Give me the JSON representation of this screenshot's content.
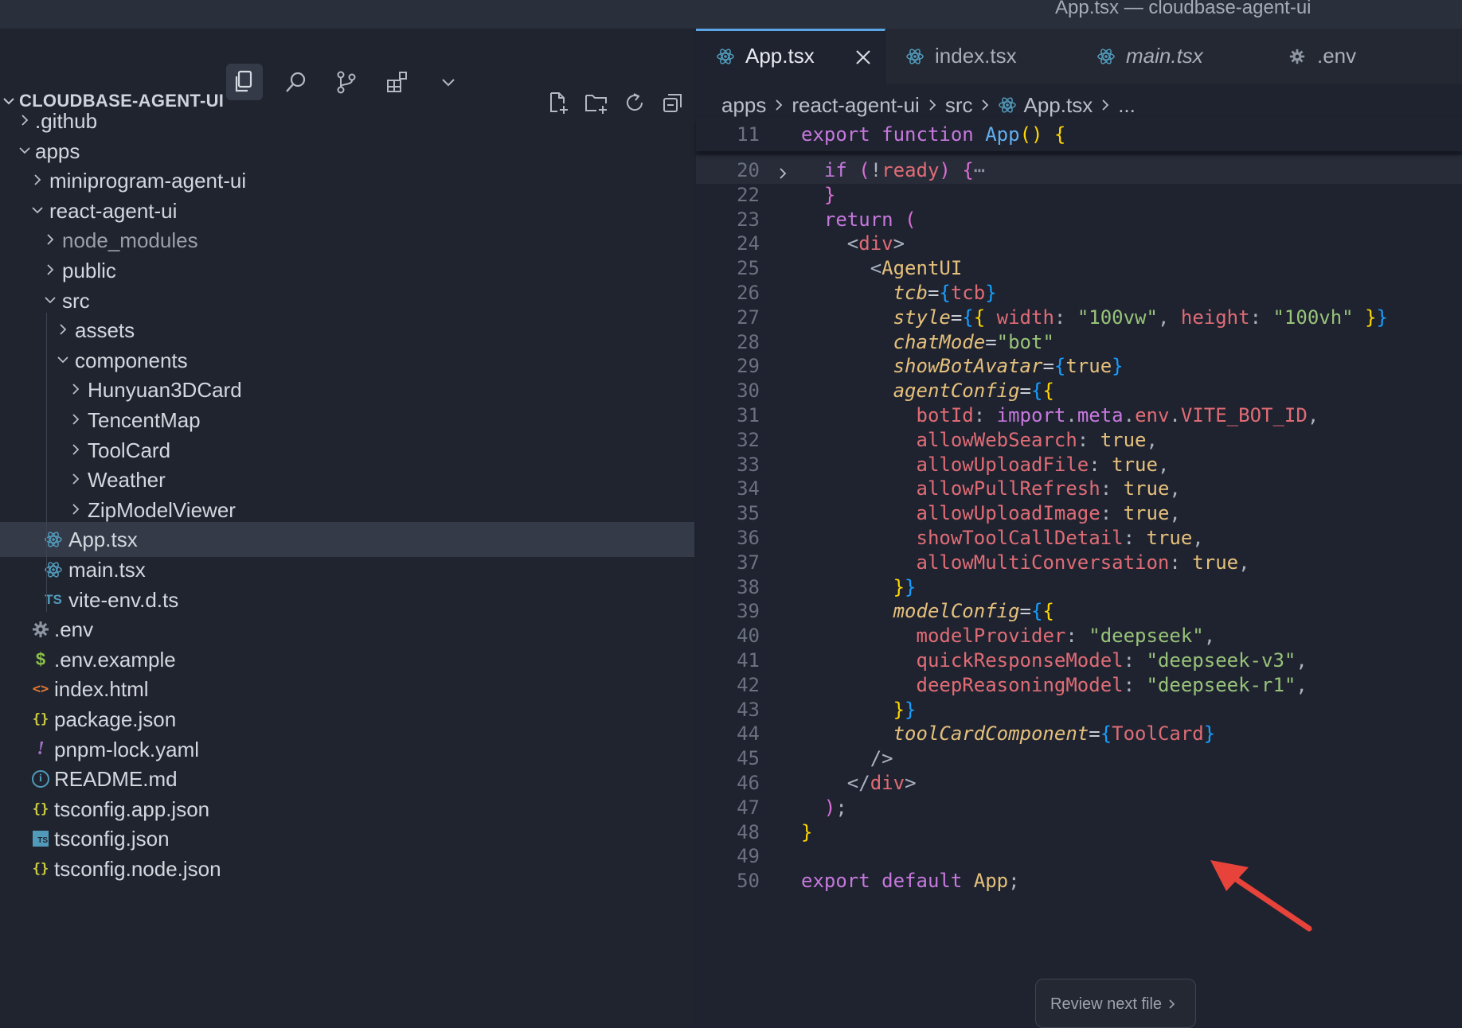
{
  "window": {
    "title": "App.tsx — cloudbase-agent-ui"
  },
  "activity_icons": [
    "files-icon",
    "search-icon",
    "source-control-icon",
    "extensions-icon",
    "more-chevron-icon"
  ],
  "explorer": {
    "section_title": "CLOUDBASE-AGENT-UI",
    "tools": [
      "new-file-icon",
      "new-folder-icon",
      "refresh-icon",
      "collapse-all-icon"
    ],
    "items": [
      {
        "label": ".github",
        "kind": "folder",
        "expanded": false,
        "depth": 1
      },
      {
        "label": "apps",
        "kind": "folder",
        "expanded": true,
        "depth": 1
      },
      {
        "label": "miniprogram-agent-ui",
        "kind": "folder",
        "expanded": false,
        "depth": 2
      },
      {
        "label": "react-agent-ui",
        "kind": "folder",
        "expanded": true,
        "depth": 2
      },
      {
        "label": "node_modules",
        "kind": "folder",
        "expanded": false,
        "depth": 3,
        "dim": true
      },
      {
        "label": "public",
        "kind": "folder",
        "expanded": false,
        "depth": 3
      },
      {
        "label": "src",
        "kind": "folder",
        "expanded": true,
        "depth": 3
      },
      {
        "label": "assets",
        "kind": "folder",
        "expanded": false,
        "depth": 4
      },
      {
        "label": "components",
        "kind": "folder",
        "expanded": true,
        "depth": 4
      },
      {
        "label": "Hunyuan3DCard",
        "kind": "folder",
        "expanded": false,
        "depth": 5
      },
      {
        "label": "TencentMap",
        "kind": "folder",
        "expanded": false,
        "depth": 5
      },
      {
        "label": "ToolCard",
        "kind": "folder",
        "expanded": false,
        "depth": 5
      },
      {
        "label": "Weather",
        "kind": "folder",
        "expanded": false,
        "depth": 5
      },
      {
        "label": "ZipModelViewer",
        "kind": "folder",
        "expanded": false,
        "depth": 5
      },
      {
        "label": "App.tsx",
        "kind": "file",
        "icon": "react-icon",
        "depth": 4,
        "selected": true
      },
      {
        "label": "main.tsx",
        "kind": "file",
        "icon": "react-icon",
        "depth": 4
      },
      {
        "label": "vite-env.d.ts",
        "kind": "file",
        "icon": "typescript-icon",
        "icon_text": "TS",
        "depth": 4
      },
      {
        "label": ".env",
        "kind": "file",
        "icon": "gear-icon",
        "depth": 3
      },
      {
        "label": ".env.example",
        "kind": "file",
        "icon": "dollar-icon",
        "icon_text": "$",
        "depth": 3
      },
      {
        "label": "index.html",
        "kind": "file",
        "icon": "html-icon",
        "icon_text": "<>",
        "depth": 3
      },
      {
        "label": "package.json",
        "kind": "file",
        "icon": "json-icon",
        "icon_text": "{}",
        "depth": 3
      },
      {
        "label": "pnpm-lock.yaml",
        "kind": "file",
        "icon": "yaml-icon",
        "icon_text": "!",
        "depth": 3
      },
      {
        "label": "README.md",
        "kind": "file",
        "icon": "info-icon",
        "icon_text": "i",
        "depth": 3
      },
      {
        "label": "tsconfig.app.json",
        "kind": "file",
        "icon": "json-icon",
        "icon_text": "{}",
        "depth": 3
      },
      {
        "label": "tsconfig.json",
        "kind": "file",
        "icon": "tsconfig-icon",
        "icon_text": "TS",
        "depth": 3
      },
      {
        "label": "tsconfig.node.json",
        "kind": "file",
        "icon": "json-icon",
        "icon_text": "{}",
        "depth": 3
      }
    ]
  },
  "tabs": [
    {
      "label": "App.tsx",
      "icon": "react-icon",
      "active": true,
      "italic": false,
      "close": "×"
    },
    {
      "label": "index.tsx",
      "icon": "react-icon",
      "active": false,
      "italic": false
    },
    {
      "label": "main.tsx",
      "icon": "react-icon",
      "active": false,
      "italic": true
    },
    {
      "label": ".env",
      "icon": "gear-icon",
      "active": false,
      "italic": false
    }
  ],
  "breadcrumbs": [
    "apps",
    "react-agent-ui",
    "src",
    "App.tsx",
    "..."
  ],
  "editor": {
    "sticky": {
      "line": "11",
      "tokens": [
        [
          "kw",
          "export"
        ],
        [
          "plain",
          " "
        ],
        [
          "kw",
          "function"
        ],
        [
          "plain",
          " "
        ],
        [
          "fn",
          "App"
        ],
        [
          "br1",
          "()"
        ],
        [
          "plain",
          " "
        ],
        [
          "br1",
          "{"
        ]
      ]
    },
    "lines": [
      {
        "n": "20",
        "fold": true,
        "hl": true,
        "tokens": [
          [
            "plain",
            "  "
          ],
          [
            "kw",
            "if"
          ],
          [
            "plain",
            " "
          ],
          [
            "br2",
            "("
          ],
          [
            "pu",
            "!"
          ],
          [
            "ident",
            "ready"
          ],
          [
            "br2",
            ")"
          ],
          [
            "plain",
            " "
          ],
          [
            "br2",
            "{"
          ],
          [
            "ellipsis",
            "⋯"
          ]
        ]
      },
      {
        "n": "22",
        "tokens": [
          [
            "plain",
            "  "
          ],
          [
            "br2",
            "}"
          ]
        ]
      },
      {
        "n": "23",
        "tokens": [
          [
            "plain",
            "  "
          ],
          [
            "kw",
            "return"
          ],
          [
            "plain",
            " "
          ],
          [
            "br2",
            "("
          ]
        ]
      },
      {
        "n": "24",
        "tokens": [
          [
            "plain",
            "    "
          ],
          [
            "pu",
            "<"
          ],
          [
            "tag",
            "div"
          ],
          [
            "pu",
            ">"
          ]
        ]
      },
      {
        "n": "25",
        "tokens": [
          [
            "plain",
            "      "
          ],
          [
            "pu",
            "<"
          ],
          [
            "attr-n",
            "AgentUI"
          ]
        ]
      },
      {
        "n": "26",
        "tokens": [
          [
            "plain",
            "        "
          ],
          [
            "attr",
            "tcb"
          ],
          [
            "op",
            "="
          ],
          [
            "br3",
            "{"
          ],
          [
            "ident",
            "tcb"
          ],
          [
            "br3",
            "}"
          ]
        ]
      },
      {
        "n": "27",
        "tokens": [
          [
            "plain",
            "        "
          ],
          [
            "attr",
            "style"
          ],
          [
            "op",
            "="
          ],
          [
            "br3",
            "{"
          ],
          [
            "br1",
            "{"
          ],
          [
            "plain",
            " "
          ],
          [
            "prop",
            "width"
          ],
          [
            "pu",
            ": "
          ],
          [
            "str",
            "\"100vw\""
          ],
          [
            "pu",
            ", "
          ],
          [
            "prop",
            "height"
          ],
          [
            "pu",
            ": "
          ],
          [
            "str",
            "\"100vh\""
          ],
          [
            "plain",
            " "
          ],
          [
            "br1",
            "}"
          ],
          [
            "br3",
            "}"
          ]
        ]
      },
      {
        "n": "28",
        "tokens": [
          [
            "plain",
            "        "
          ],
          [
            "attr",
            "chatMode"
          ],
          [
            "op",
            "="
          ],
          [
            "str",
            "\"bot\""
          ]
        ]
      },
      {
        "n": "29",
        "tokens": [
          [
            "plain",
            "        "
          ],
          [
            "attr",
            "showBotAvatar"
          ],
          [
            "op",
            "="
          ],
          [
            "br3",
            "{"
          ],
          [
            "bool",
            "true"
          ],
          [
            "br3",
            "}"
          ]
        ]
      },
      {
        "n": "30",
        "tokens": [
          [
            "plain",
            "        "
          ],
          [
            "attr",
            "agentConfig"
          ],
          [
            "op",
            "="
          ],
          [
            "br3",
            "{"
          ],
          [
            "br1",
            "{"
          ]
        ]
      },
      {
        "n": "31",
        "tokens": [
          [
            "plain",
            "          "
          ],
          [
            "prop",
            "botId"
          ],
          [
            "pu",
            ": "
          ],
          [
            "meta",
            "import"
          ],
          [
            "pu",
            "."
          ],
          [
            "meta",
            "meta"
          ],
          [
            "pu",
            "."
          ],
          [
            "env",
            "env"
          ],
          [
            "pu",
            "."
          ],
          [
            "env",
            "VITE_BOT_ID"
          ],
          [
            "pu",
            ","
          ]
        ]
      },
      {
        "n": "32",
        "tokens": [
          [
            "plain",
            "          "
          ],
          [
            "prop",
            "allowWebSearch"
          ],
          [
            "pu",
            ": "
          ],
          [
            "bool",
            "true"
          ],
          [
            "pu",
            ","
          ]
        ]
      },
      {
        "n": "33",
        "tokens": [
          [
            "plain",
            "          "
          ],
          [
            "prop",
            "allowUploadFile"
          ],
          [
            "pu",
            ": "
          ],
          [
            "bool",
            "true"
          ],
          [
            "pu",
            ","
          ]
        ]
      },
      {
        "n": "34",
        "tokens": [
          [
            "plain",
            "          "
          ],
          [
            "prop",
            "allowPullRefresh"
          ],
          [
            "pu",
            ": "
          ],
          [
            "bool",
            "true"
          ],
          [
            "pu",
            ","
          ]
        ]
      },
      {
        "n": "35",
        "tokens": [
          [
            "plain",
            "          "
          ],
          [
            "prop",
            "allowUploadImage"
          ],
          [
            "pu",
            ": "
          ],
          [
            "bool",
            "true"
          ],
          [
            "pu",
            ","
          ]
        ]
      },
      {
        "n": "36",
        "tokens": [
          [
            "plain",
            "          "
          ],
          [
            "prop",
            "showToolCallDetail"
          ],
          [
            "pu",
            ": "
          ],
          [
            "bool",
            "true"
          ],
          [
            "pu",
            ","
          ]
        ]
      },
      {
        "n": "37",
        "tokens": [
          [
            "plain",
            "          "
          ],
          [
            "prop",
            "allowMultiConversation"
          ],
          [
            "pu",
            ": "
          ],
          [
            "bool",
            "true"
          ],
          [
            "pu",
            ","
          ]
        ]
      },
      {
        "n": "38",
        "tokens": [
          [
            "plain",
            "        "
          ],
          [
            "br1",
            "}"
          ],
          [
            "br3",
            "}"
          ]
        ]
      },
      {
        "n": "39",
        "tokens": [
          [
            "plain",
            "        "
          ],
          [
            "attr",
            "modelConfig"
          ],
          [
            "op",
            "="
          ],
          [
            "br3",
            "{"
          ],
          [
            "br1",
            "{"
          ]
        ]
      },
      {
        "n": "40",
        "tokens": [
          [
            "plain",
            "          "
          ],
          [
            "prop",
            "modelProvider"
          ],
          [
            "pu",
            ": "
          ],
          [
            "str",
            "\"deepseek\""
          ],
          [
            "pu",
            ","
          ]
        ]
      },
      {
        "n": "41",
        "tokens": [
          [
            "plain",
            "          "
          ],
          [
            "prop",
            "quickResponseModel"
          ],
          [
            "pu",
            ": "
          ],
          [
            "str",
            "\"deepseek-v3\""
          ],
          [
            "pu",
            ","
          ]
        ]
      },
      {
        "n": "42",
        "tokens": [
          [
            "plain",
            "          "
          ],
          [
            "prop",
            "deepReasoningModel"
          ],
          [
            "pu",
            ": "
          ],
          [
            "str",
            "\"deepseek-r1\""
          ],
          [
            "pu",
            ","
          ]
        ]
      },
      {
        "n": "43",
        "tokens": [
          [
            "plain",
            "        "
          ],
          [
            "br1",
            "}"
          ],
          [
            "br3",
            "}"
          ]
        ]
      },
      {
        "n": "44",
        "tokens": [
          [
            "plain",
            "        "
          ],
          [
            "attr",
            "toolCardComponent"
          ],
          [
            "op",
            "="
          ],
          [
            "br3",
            "{"
          ],
          [
            "ident",
            "ToolCard"
          ],
          [
            "br3",
            "}"
          ]
        ]
      },
      {
        "n": "45",
        "tokens": [
          [
            "plain",
            "      "
          ],
          [
            "pu",
            "/>"
          ]
        ]
      },
      {
        "n": "46",
        "tokens": [
          [
            "plain",
            "    "
          ],
          [
            "pu",
            "</"
          ],
          [
            "tag",
            "div"
          ],
          [
            "pu",
            ">"
          ]
        ]
      },
      {
        "n": "47",
        "tokens": [
          [
            "plain",
            "  "
          ],
          [
            "br2",
            ")"
          ],
          [
            "pu",
            ";"
          ]
        ]
      },
      {
        "n": "48",
        "tokens": [
          [
            "br1",
            "}"
          ]
        ]
      },
      {
        "n": "49",
        "tokens": []
      },
      {
        "n": "50",
        "tokens": [
          [
            "kw",
            "export"
          ],
          [
            "plain",
            " "
          ],
          [
            "kw",
            "default"
          ],
          [
            "plain",
            " "
          ],
          [
            "br1-app",
            "App"
          ],
          [
            "pu",
            ";"
          ]
        ]
      }
    ]
  },
  "review_button": {
    "label": "Review next file",
    "chevron": "›"
  },
  "colors": {
    "accent": "#5aa5e6",
    "arrow": "#e8433a",
    "react": "#519aba",
    "selection": "#343a48"
  }
}
